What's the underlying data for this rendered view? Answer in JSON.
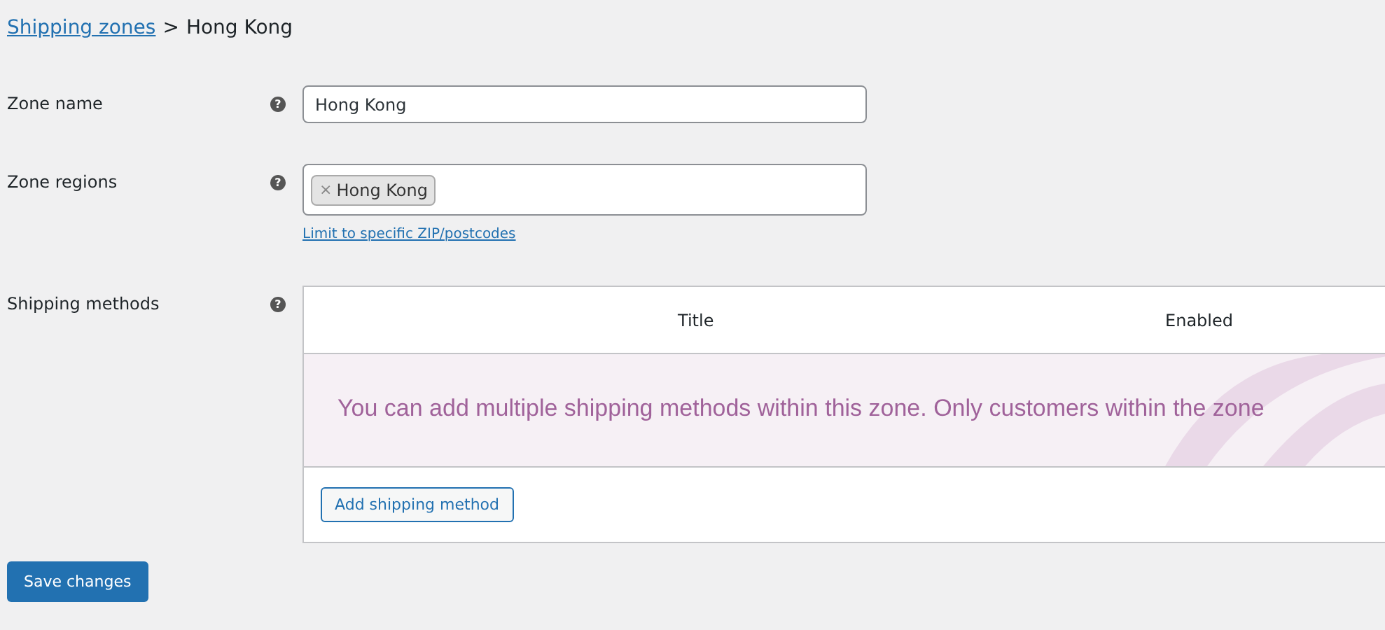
{
  "breadcrumb": {
    "link": "Shipping zones",
    "separator": ">",
    "current": "Hong Kong"
  },
  "zone_name": {
    "label": "Zone name",
    "help": "?",
    "value": "Hong Kong"
  },
  "zone_regions": {
    "label": "Zone regions",
    "help": "?",
    "tags": [
      {
        "remove": "×",
        "label": "Hong Kong"
      }
    ],
    "link": "Limit to specific ZIP/postcodes"
  },
  "shipping_methods": {
    "label": "Shipping methods",
    "help": "?",
    "columns": [
      "Title",
      "Enabled"
    ],
    "empty_message": "You can add multiple shipping methods within this zone. Only customers within the zone",
    "add_button": "Add shipping method"
  },
  "save_button": "Save changes"
}
